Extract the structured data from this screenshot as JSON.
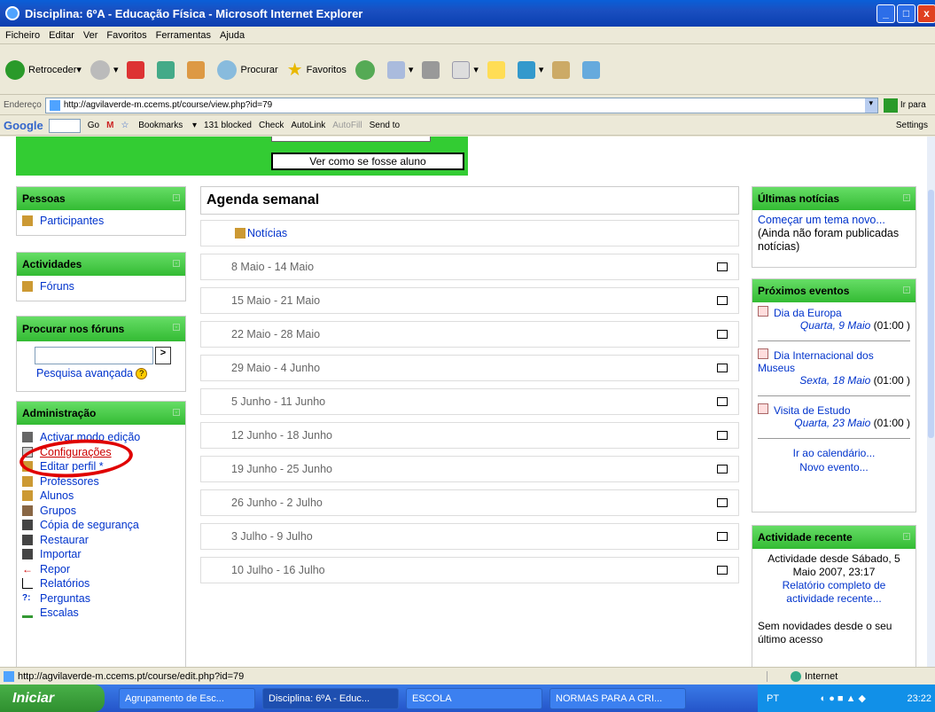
{
  "window": {
    "title": "Disciplina: 6ºA - Educação Física - Microsoft Internet Explorer"
  },
  "menu": [
    "Ficheiro",
    "Editar",
    "Ver",
    "Favoritos",
    "Ferramentas",
    "Ajuda"
  ],
  "toolbar": {
    "back": "Retroceder",
    "search": "Procurar",
    "favorites": "Favoritos"
  },
  "address": {
    "label": "Endereço",
    "url": "http://agvilaverde-m.ccems.pt/course/view.php?id=79",
    "go": "Ir para"
  },
  "google": {
    "logo": "Google",
    "go": "Go",
    "bookmarks": "Bookmarks",
    "blocked": "131 blocked",
    "check": "Check",
    "autolink": "AutoLink",
    "autofill": "AutoFill",
    "sendto": "Send to",
    "settings": "Settings"
  },
  "course": {
    "view_student": "Ver como se fosse aluno",
    "edit_mode_top": "Activar modo edição"
  },
  "pessoas": {
    "title": "Pessoas",
    "items": [
      "Participantes"
    ]
  },
  "actividades": {
    "title": "Actividades",
    "items": [
      "Fóruns"
    ]
  },
  "procurar": {
    "title": "Procurar nos fóruns",
    "go": ">",
    "advanced": "Pesquisa avançada"
  },
  "admin": {
    "title": "Administração",
    "items": [
      "Activar modo edição",
      "Configurações",
      "Editar perfil *",
      "Professores",
      "Alunos",
      "Grupos",
      "Cópia de segurança",
      "Restaurar",
      "Importar",
      "Repor",
      "Relatórios",
      "Perguntas",
      "Escalas"
    ]
  },
  "agenda": {
    "title": "Agenda semanal",
    "news": "Notícias",
    "weeks": [
      "8 Maio - 14 Maio",
      "15 Maio - 21 Maio",
      "22 Maio - 28 Maio",
      "29 Maio - 4 Junho",
      "5 Junho - 11 Junho",
      "12 Junho - 18 Junho",
      "19 Junho - 25 Junho",
      "26 Junho - 2 Julho",
      "3 Julho - 9 Julho",
      "10 Julho - 16 Julho"
    ]
  },
  "noticias": {
    "title": "Últimas notícias",
    "new_topic": "Começar um tema novo...",
    "none": "(Ainda não foram publicadas notícias)"
  },
  "eventos": {
    "title": "Próximos eventos",
    "items": [
      {
        "name": "Dia da Europa",
        "date": "Quarta, 9 Maio",
        "time": "(01:00 )"
      },
      {
        "name": "Dia Internacional dos Museus",
        "date": "Sexta, 18 Maio",
        "time": "(01:00 )"
      },
      {
        "name": "Visita de Estudo",
        "date": "Quarta, 23 Maio",
        "time": "(01:00 )"
      }
    ],
    "calendar": "Ir ao calendário...",
    "new_event": "Novo evento..."
  },
  "recente": {
    "title": "Actividade recente",
    "since": "Actividade desde Sábado, 5 Maio 2007, 23:17",
    "report": "Relatório completo de actividade recente...",
    "nothing": "Sem novidades desde o seu último acesso"
  },
  "status": {
    "url": "http://agvilaverde-m.ccems.pt/course/edit.php?id=79",
    "zone": "Internet"
  },
  "taskbar": {
    "start": "Iniciar",
    "tasks": [
      "Agrupamento de Esc...",
      "Disciplina: 6ºA - Educ...",
      "ESCOLA",
      "NORMAS PARA A CRI..."
    ],
    "lang": "PT",
    "clock": "23:22"
  },
  "colors": {
    "block_header": "#33cc33",
    "link": "#0033cc",
    "annotation": "#e00000"
  }
}
